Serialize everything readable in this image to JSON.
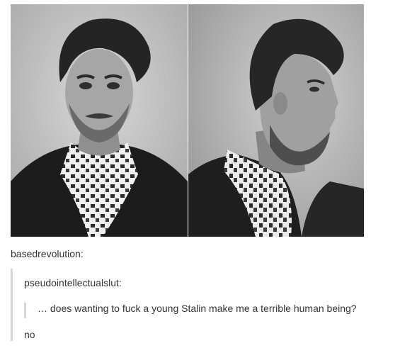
{
  "photos": [
    {
      "icon": "portrait-front-photo"
    },
    {
      "icon": "portrait-profile-photo"
    }
  ],
  "post": {
    "reblogger": "basedrevolution:",
    "original_poster": "pseudointellectualslut:",
    "quote": "… does wanting to fuck a young Stalin make me a terrible human being?",
    "reply": "no"
  },
  "colors": {
    "quote_bar": "#d6d6d6",
    "text": "#333333",
    "background": "#ffffff"
  }
}
